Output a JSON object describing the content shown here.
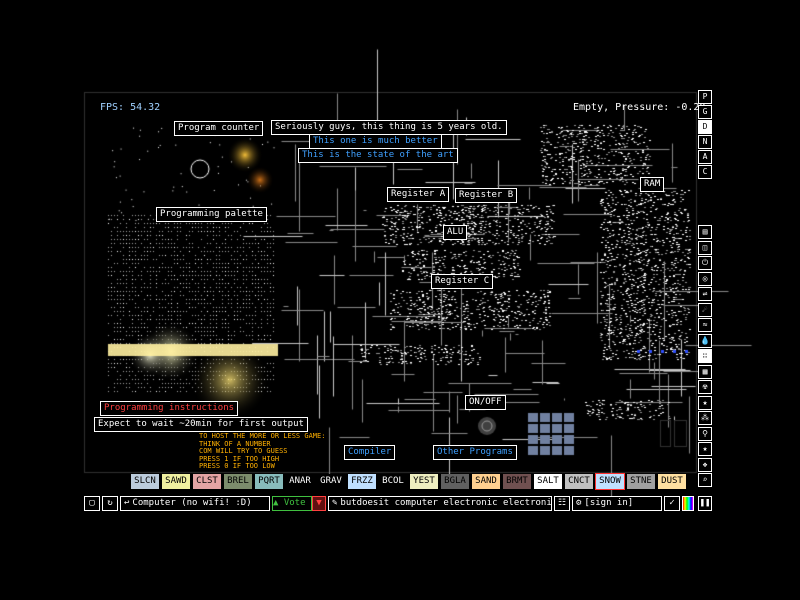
{
  "hud": {
    "fps": "FPS: 54.32",
    "status": "Empty, Pressure: -0.20"
  },
  "signs": {
    "program_counter": "Program counter",
    "seriously": "Seriously guys, this thing is 5 years old.",
    "much_better": "This one is much better",
    "state_of_art": "This is the state of the art",
    "ram": "RAM",
    "register_a": "Register A",
    "register_b": "Register B",
    "programming_palette": "Programming palette",
    "alu": "ALU",
    "register_c": "Register C",
    "on_off": "ON/OFF",
    "programming_instructions": "Programming instructions",
    "expect_wait": "Expect to wait ~20min for first output",
    "compiler": "Compiler",
    "other_programs": "Other Programs"
  },
  "instructions_note": "TO HOST THE MORE OR LESS GAME:\nTHINK OF A NUMBER\nCOM WILL TRY TO GUESS\nPRESS 1 IF TOO HIGH\nPRESS 0 IF TOO LOW",
  "right_letters": [
    "P",
    "G",
    "D",
    "N",
    "A",
    "C"
  ],
  "right_icons": [
    "walls-icon",
    "electronics-icon",
    "power-icon",
    "sensors-icon",
    "force-icon",
    "explosives-icon",
    "gases-icon",
    "liquids-icon",
    "powders-icon",
    "solids-icon",
    "radioactive-icon",
    "special-icon",
    "life-icon",
    "tools-icon",
    "favorites-icon",
    "decoration-icon",
    "search-icon"
  ],
  "elements": [
    {
      "label": "SLCN",
      "bg": "#bcccdc",
      "fg": "#000000"
    },
    {
      "label": "SAWD",
      "bg": "#f0f0a0",
      "fg": "#000000"
    },
    {
      "label": "CLST",
      "bg": "#e4a4a4",
      "fg": "#000000"
    },
    {
      "label": "BREL",
      "bg": "#7c8c6c",
      "fg": "#000000"
    },
    {
      "label": "PQRT",
      "bg": "#88bcbc",
      "fg": "#000000"
    },
    {
      "label": "ANAR",
      "bg": "#000000",
      "fg": "#ffffff"
    },
    {
      "label": "GRAV",
      "bg": "#000000",
      "fg": "#ffffff"
    },
    {
      "label": "FRZZ",
      "bg": "#c0e0ff",
      "fg": "#000000"
    },
    {
      "label": "BCOL",
      "bg": "#000000",
      "fg": "#ffffff"
    },
    {
      "label": "YEST",
      "bg": "#eeeec0",
      "fg": "#000000"
    },
    {
      "label": "BGLA",
      "bg": "#606060",
      "fg": "#000000"
    },
    {
      "label": "SAND",
      "bg": "#ffd090",
      "fg": "#000000"
    },
    {
      "label": "BRMT",
      "bg": "#705050",
      "fg": "#000000"
    },
    {
      "label": "SALT",
      "bg": "#ffffff",
      "fg": "#000000"
    },
    {
      "label": "CNCT",
      "bg": "#c0c0c0",
      "fg": "#000000"
    },
    {
      "label": "SNOW",
      "bg": "#c0e0ff",
      "fg": "#000000",
      "selected": true
    },
    {
      "label": "STNE",
      "bg": "#a0a0a0",
      "fg": "#000000"
    },
    {
      "label": "DUST",
      "bg": "#ffe0a0",
      "fg": "#000000"
    }
  ],
  "bottom": {
    "save_title": "Computer (no wifi! :D)",
    "vote": "Vote",
    "tags": "butdoesit computer electronic electronic...",
    "sign_in": "[sign in]"
  }
}
